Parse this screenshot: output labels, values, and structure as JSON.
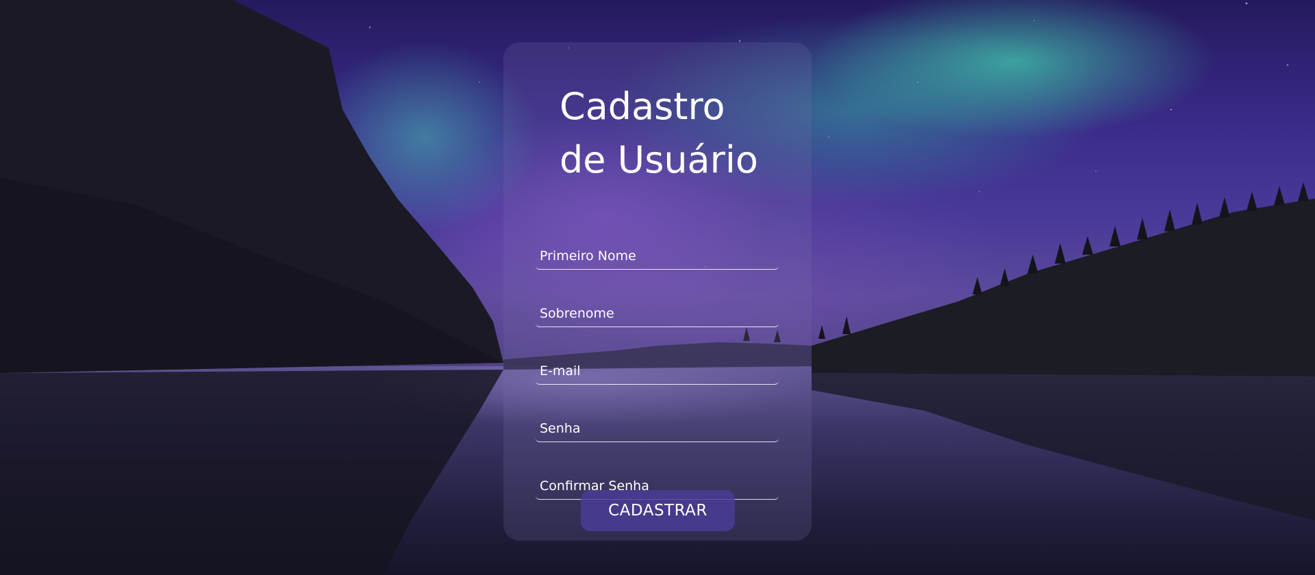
{
  "page": {
    "title_line1": "Cadastro",
    "title_line2": "de Usuário"
  },
  "form": {
    "first_name_placeholder": "Primeiro Nome",
    "last_name_placeholder": "Sobrenome",
    "email_placeholder": "E-mail",
    "password_placeholder": "Senha",
    "confirm_password_placeholder": "Confirmar Senha",
    "submit_label": "CADASTRAR"
  },
  "colors": {
    "sky_top": "#241a5e",
    "aurora_green": "#40c8aa",
    "card_tint": "#786eaa",
    "button_fill": "#4a3c96",
    "text": "#ffffff"
  }
}
